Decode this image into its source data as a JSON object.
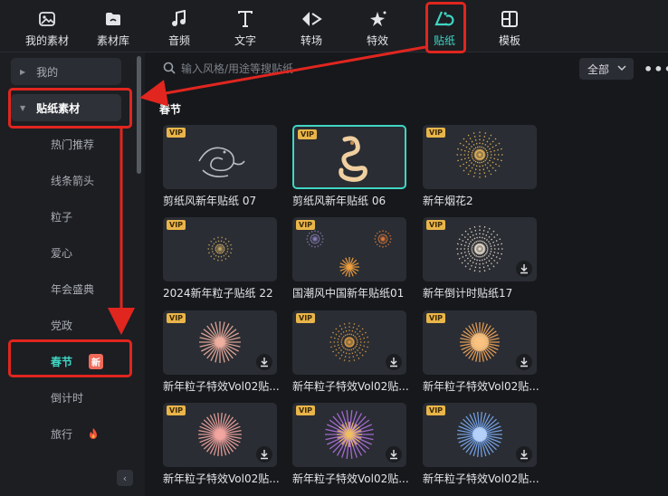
{
  "topbar": {
    "tabs": [
      {
        "label": "我的素材",
        "icon": "my-assets-icon"
      },
      {
        "label": "素材库",
        "icon": "library-icon"
      },
      {
        "label": "音频",
        "icon": "music-note-icon"
      },
      {
        "label": "文字",
        "icon": "text-icon"
      },
      {
        "label": "转场",
        "icon": "transition-icon"
      },
      {
        "label": "特效",
        "icon": "effects-icon"
      },
      {
        "label": "贴纸",
        "icon": "sticker-icon"
      },
      {
        "label": "模板",
        "icon": "template-icon"
      }
    ],
    "active_tab": "贴纸"
  },
  "sidebar": {
    "items": [
      {
        "label": "我的"
      },
      {
        "label": "贴纸素材"
      },
      {
        "label": "热门推荐"
      },
      {
        "label": "线条箭头"
      },
      {
        "label": "粒子"
      },
      {
        "label": "爱心"
      },
      {
        "label": "年会盛典"
      },
      {
        "label": "党政"
      },
      {
        "label": "春节",
        "badge": "新"
      },
      {
        "label": "倒计时"
      },
      {
        "label": "旅行",
        "icon": "fire-icon"
      }
    ]
  },
  "search": {
    "placeholder": "输入风格/用途等搜贴纸",
    "value": ""
  },
  "filter": {
    "selected": "全部"
  },
  "section": {
    "title": "春节"
  },
  "cards": [
    {
      "title": "剪纸风新年贴纸 07",
      "vip": "VIP",
      "art": "dragon-outline"
    },
    {
      "title": "剪纸风新年贴纸 06",
      "vip": "VIP",
      "art": "dragon-gold"
    },
    {
      "title": "新年烟花2",
      "vip": "VIP",
      "art": "firework-sparkle"
    },
    {
      "title": "2024新年粒子贴纸 22",
      "vip": "VIP",
      "art": "firework-small"
    },
    {
      "title": "国潮风中国新年贴纸01",
      "vip": "VIP",
      "art": "firework-trio"
    },
    {
      "title": "新年倒计时贴纸17",
      "vip": "VIP",
      "art": "firework-white"
    },
    {
      "title": "新年粒子特效Vol02贴...",
      "vip": "VIP",
      "art": "firework-pink-burst"
    },
    {
      "title": "新年粒子特效Vol02贴...",
      "vip": "VIP",
      "art": "firework-gold-dust"
    },
    {
      "title": "新年粒子特效Vol02贴...",
      "vip": "VIP",
      "art": "firework-orange"
    },
    {
      "title": "新年粒子特效Vol02贴...",
      "vip": "VIP",
      "art": "firework-pink"
    },
    {
      "title": "新年粒子特效Vol02贴...",
      "vip": "VIP",
      "art": "firework-purple-gold"
    },
    {
      "title": "新年粒子特效Vol02贴...",
      "vip": "VIP",
      "art": "firework-blue"
    }
  ],
  "colors": {
    "accent": "#3fd6c4",
    "annotation": "#e0261f",
    "vip": "#e9b54a",
    "background": "#16181c"
  }
}
